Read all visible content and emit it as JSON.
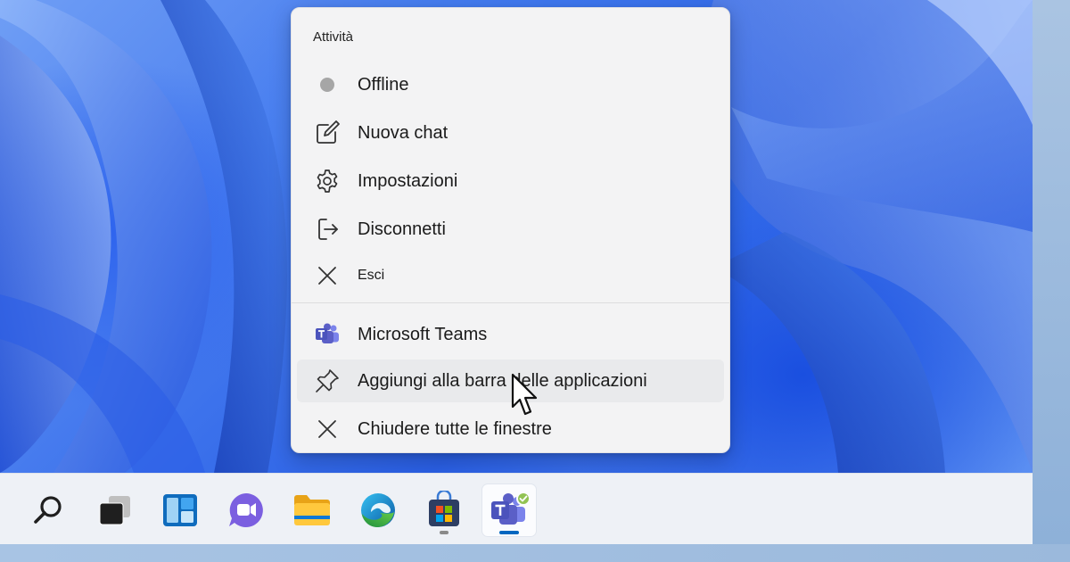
{
  "jumplist": {
    "section_title": "Attività",
    "tasks": [
      {
        "label": "Offline",
        "icon": "status-dot-icon"
      },
      {
        "label": "Nuova chat",
        "icon": "compose-icon"
      },
      {
        "label": "Impostazioni",
        "icon": "gear-icon"
      },
      {
        "label": "Disconnetti",
        "icon": "sign-out-icon"
      },
      {
        "label": "Esci",
        "icon": "close-icon"
      }
    ],
    "app": {
      "label": "Microsoft Teams",
      "icon": "teams-icon"
    },
    "pin": {
      "label": "Aggiungi alla barra delle applicazioni",
      "icon": "pin-icon"
    },
    "close_all": {
      "label": "Chiudere tutte le finestre",
      "icon": "close-icon"
    }
  },
  "taskbar": {
    "items": [
      {
        "name": "search",
        "icon": "search-icon"
      },
      {
        "name": "task-view",
        "icon": "task-view-icon"
      },
      {
        "name": "widgets",
        "icon": "widgets-icon"
      },
      {
        "name": "chat",
        "icon": "chat-icon"
      },
      {
        "name": "file-explorer",
        "icon": "folder-icon"
      },
      {
        "name": "edge",
        "icon": "edge-icon"
      },
      {
        "name": "store",
        "icon": "store-icon"
      },
      {
        "name": "teams",
        "icon": "teams-icon",
        "active": true
      }
    ]
  },
  "colors": {
    "menu_bg": "#f3f3f4",
    "taskbar_bg": "#eef1f6",
    "accent": "#0067c0",
    "teams_purple": "#5b5fc7",
    "status_offline": "#a6a6a6",
    "status_available": "#92c353"
  }
}
